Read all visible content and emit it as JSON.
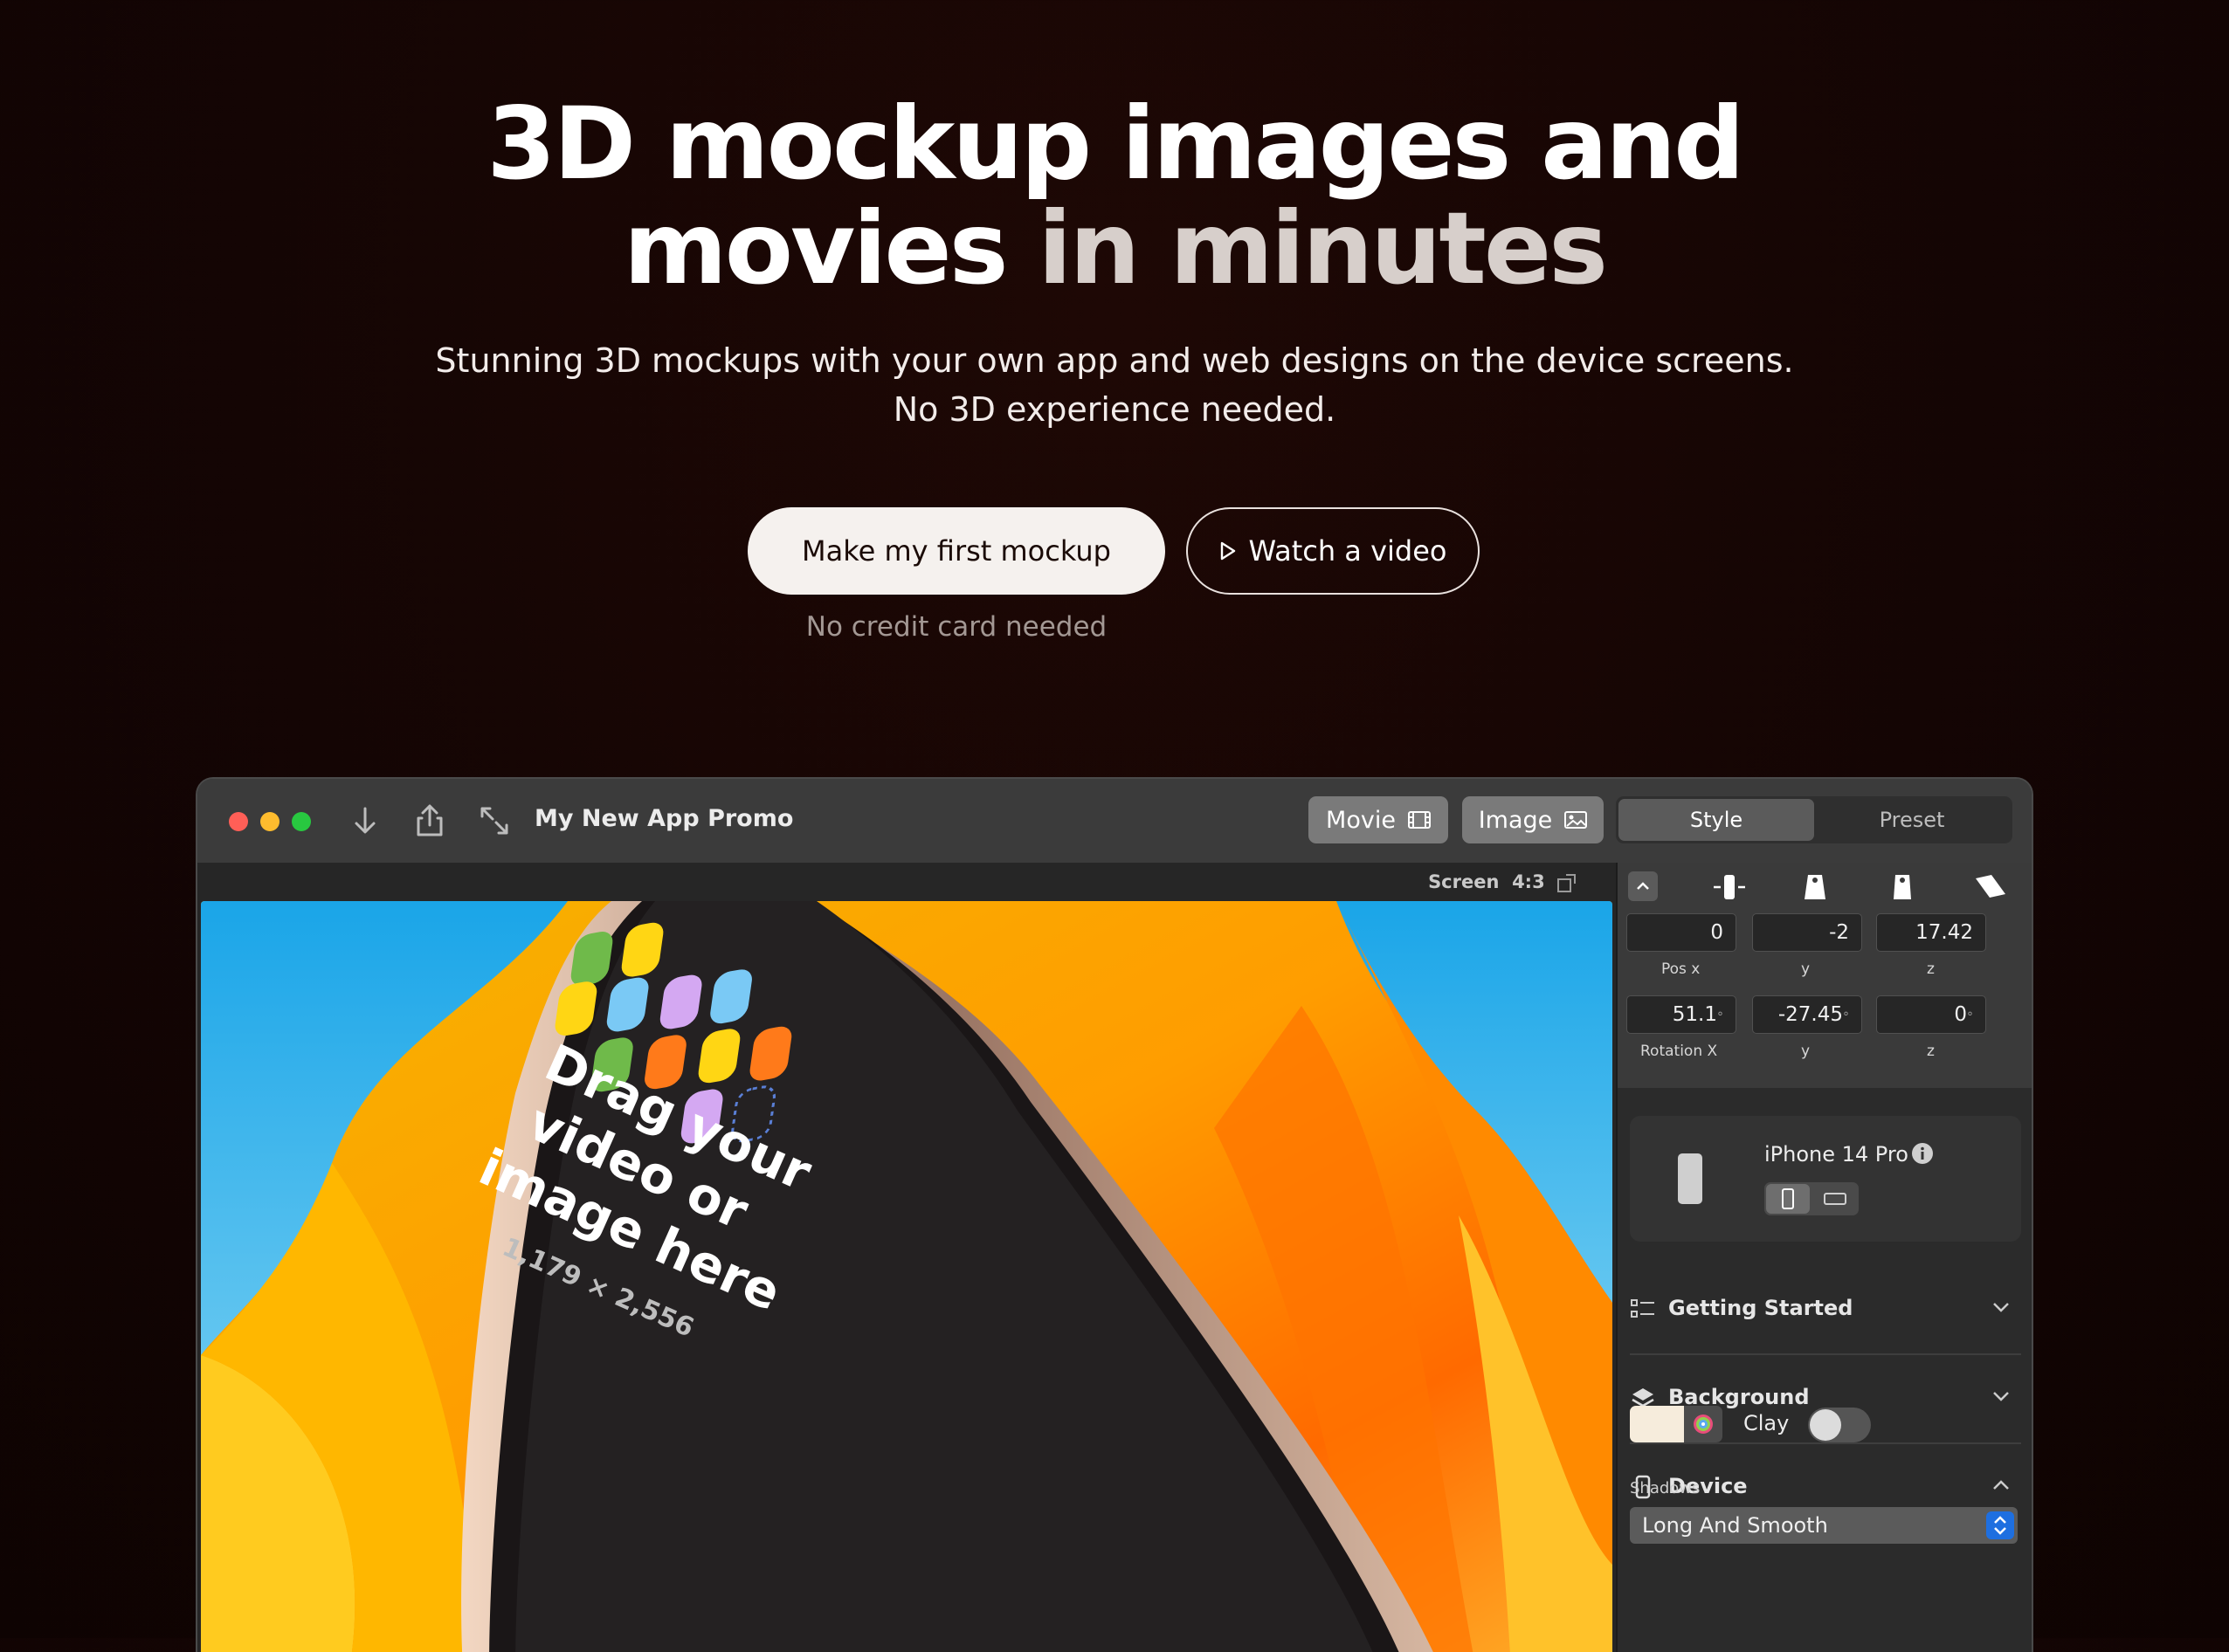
{
  "hero": {
    "title_line1": "3D mockup images and",
    "title_line2_a": "movies",
    "title_line2_b": "in minutes",
    "subtitle": "Stunning 3D mockups with your own app and web designs on the device screens. No 3D experience needed.",
    "primary_cta": "Make my first mockup",
    "secondary_cta": "Watch a video",
    "note": "No credit card needed"
  },
  "app": {
    "doc_title": "My New App Promo",
    "mode_movie": "Movie",
    "mode_image": "Image",
    "tab_style": "Style",
    "tab_preset": "Preset",
    "screen_label": "Screen",
    "screen_ratio": "4:3",
    "phone_text": [
      "Drag your",
      "video or",
      "image here"
    ],
    "phone_dims": "1,179 × 2,556",
    "pos": {
      "x": "0",
      "y": "-2",
      "z": "17.42",
      "label_x": "Pos x",
      "label_y": "y",
      "label_z": "z"
    },
    "rot": {
      "x": "51.1",
      "y": "-27.45",
      "z": "0",
      "label_x": "Rotation X",
      "label_y": "y",
      "label_z": "z",
      "unit": "°"
    },
    "device_name": "iPhone 14 Pro",
    "sections": [
      "Getting Started",
      "Background",
      "Device"
    ],
    "clay_label": "Clay",
    "shadows_label": "Shadows",
    "shadows_value": "Long And Smooth"
  },
  "colors": {
    "bg": "#140504",
    "primary_button": "#f5f1ee",
    "traffic_red": "#ff5f57",
    "traffic_yellow": "#febc2e",
    "traffic_green": "#28c840",
    "accent_blue": "#1e6fe0"
  }
}
